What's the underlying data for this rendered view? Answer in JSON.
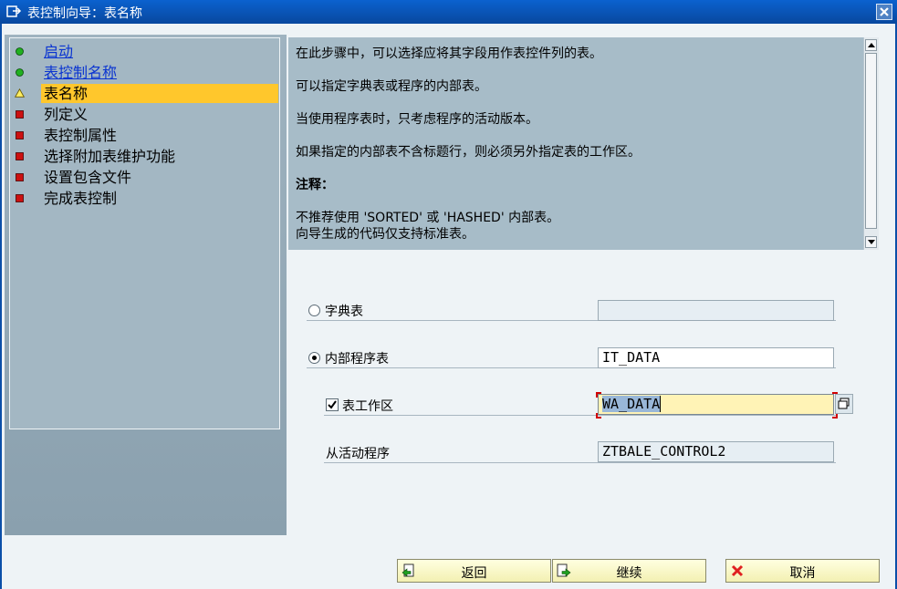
{
  "window": {
    "title": "表控制向导：表名称"
  },
  "steps": [
    {
      "label": "启动",
      "status": "done"
    },
    {
      "label": "表控制名称",
      "status": "done"
    },
    {
      "label": "表名称",
      "status": "current"
    },
    {
      "label": "列定义",
      "status": "todo"
    },
    {
      "label": "表控制属性",
      "status": "todo"
    },
    {
      "label": "选择附加表维护功能",
      "status": "todo"
    },
    {
      "label": "设置包含文件",
      "status": "todo"
    },
    {
      "label": "完成表控制",
      "status": "todo"
    }
  ],
  "info": {
    "line1": "在此步骤中，可以选择应将其字段用作表控件列的表。",
    "line2": "可以指定字典表或程序的内部表。",
    "line3": "当使用程序表时，只考虑程序的活动版本。",
    "line4": "如果指定的内部表不含标题行，则必须另外指定表的工作区。",
    "note_title": "注释：",
    "note1": "不推荐使用 'SORTED' 或 'HASHED' 内部表。",
    "note2": "向导生成的代码仅支持标准表。"
  },
  "form": {
    "dict_table": {
      "label": "字典表",
      "value": "",
      "selected": false
    },
    "internal_table": {
      "label": "内部程序表",
      "value": "IT_DATA",
      "selected": true
    },
    "work_area": {
      "label": "表工作区",
      "value": "WA_DATA",
      "checked": true
    },
    "from_program": {
      "label": "从活动程序",
      "value": "ZTBALE_CONTROL2"
    }
  },
  "buttons": {
    "back": "返回",
    "continue": "继续",
    "cancel": "取消"
  },
  "colors": {
    "done": "#20b020",
    "current": "#ffc72c",
    "todo": "#cc1010",
    "link": "#0a34d1",
    "titlebar": "#0b62cf"
  }
}
